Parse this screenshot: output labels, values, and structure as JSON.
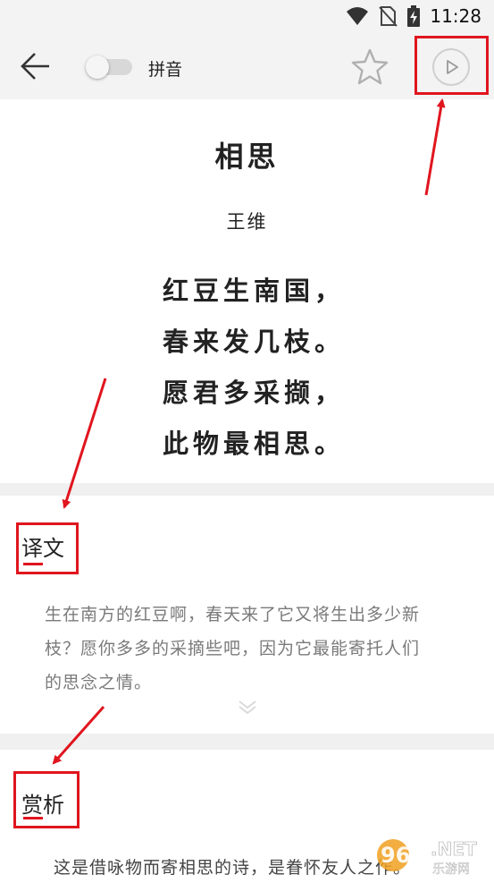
{
  "status_bar": {
    "time": "11:28"
  },
  "toolbar": {
    "pinyin_label": "拼音",
    "pinyin_enabled": false
  },
  "poem": {
    "title": "相思",
    "author": "王维",
    "lines": [
      "红豆生南国，",
      "春来发几枝。",
      "愿君多采撷，",
      "此物最相思。"
    ]
  },
  "translation": {
    "title": "译文",
    "lines": [
      "生在南方的红豆啊，春天来了它又将生出多少新",
      "枝？愿你多多的采摘些吧，因为它最能寄托人们",
      "的思念之情。"
    ]
  },
  "appreciation": {
    "title": "赏析",
    "text_partial": "这是借咏物而寄相思的诗，是眷怀友人之作。"
  },
  "watermark": {
    "brand": "962",
    "suffix": ".NET",
    "sub": "乐游网"
  },
  "colors": {
    "accent": "#e0151e",
    "appbar_bg": "#f3f3f3",
    "body_text": "#7a7a7a"
  }
}
